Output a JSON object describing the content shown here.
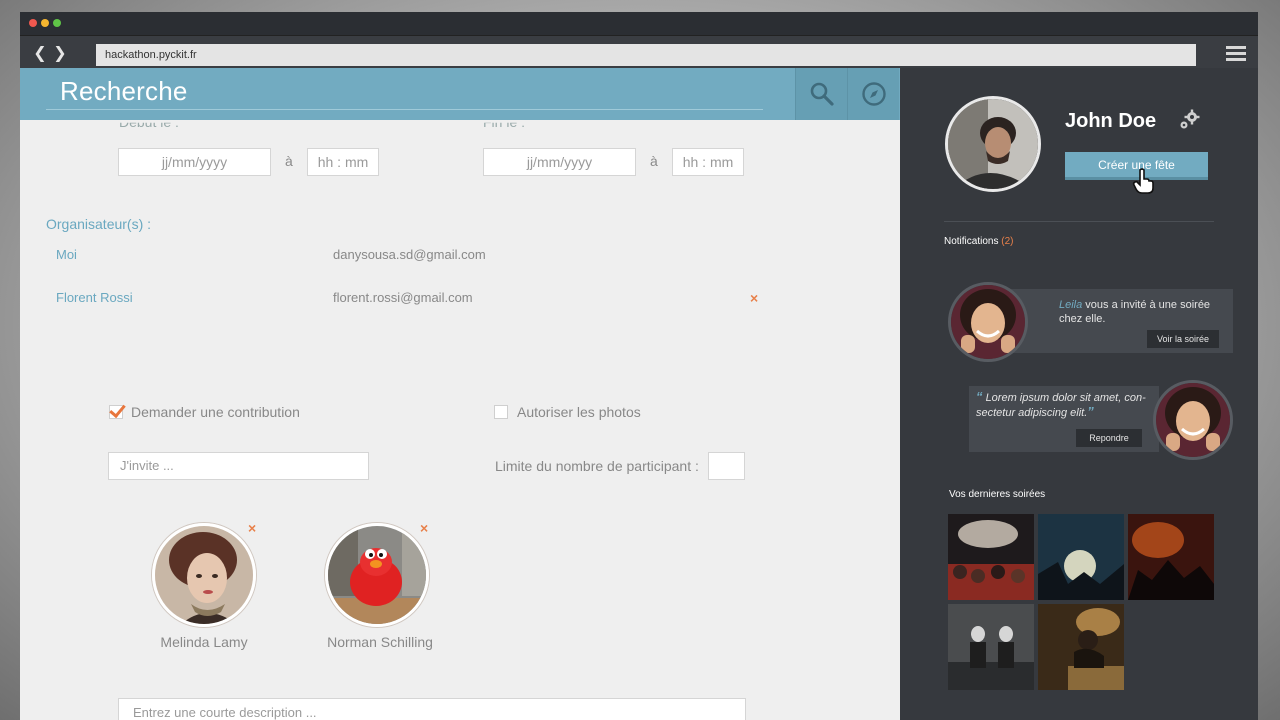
{
  "browser": {
    "url": "hackathon.pyckit.fr"
  },
  "search": {
    "title": "Recherche"
  },
  "dates": {
    "start_label": "Début le :",
    "end_label": "Fin le :",
    "date_placeholder": "jj/mm/yyyy",
    "time_placeholder": "hh : mm",
    "separator": "à"
  },
  "organizers": {
    "title": "Organisateur(s) :",
    "items": [
      {
        "name": "Moi",
        "email": "danysousa.sd@gmail.com"
      },
      {
        "name": "Florent Rossi",
        "email": "florent.rossi@gmail.com"
      }
    ],
    "remove_symbol": "×"
  },
  "options": {
    "contribution_label": "Demander une contribution",
    "contribution_checked": true,
    "photos_label": "Autoriser les photos",
    "photos_checked": false
  },
  "invite": {
    "placeholder": "J'invite ...",
    "limit_label": "Limite du nombre de participant :"
  },
  "guests": [
    {
      "name": "Melinda Lamy"
    },
    {
      "name": "Norman Schilling"
    }
  ],
  "description": {
    "placeholder": "Entrez une courte description ..."
  },
  "profile": {
    "name": "John Doe",
    "create_button": "Créer une fête"
  },
  "notifications": {
    "label": "Notifications",
    "count": "(2)",
    "items": [
      {
        "sender": "Leila",
        "text": " vous a invité à une soirée chez elle.",
        "button": "Voir la soirée"
      },
      {
        "quote_open": "“",
        "text": "Lorem ipsum dolor sit amet, con-sectetur adipiscing elit.",
        "quote_close": "”",
        "button": "Repondre"
      }
    ]
  },
  "recent": {
    "label": "Vos dernieres soirées"
  },
  "colors": {
    "accent": "#72abc1",
    "sidebar": "#36393e",
    "remove": "#e8804a"
  }
}
